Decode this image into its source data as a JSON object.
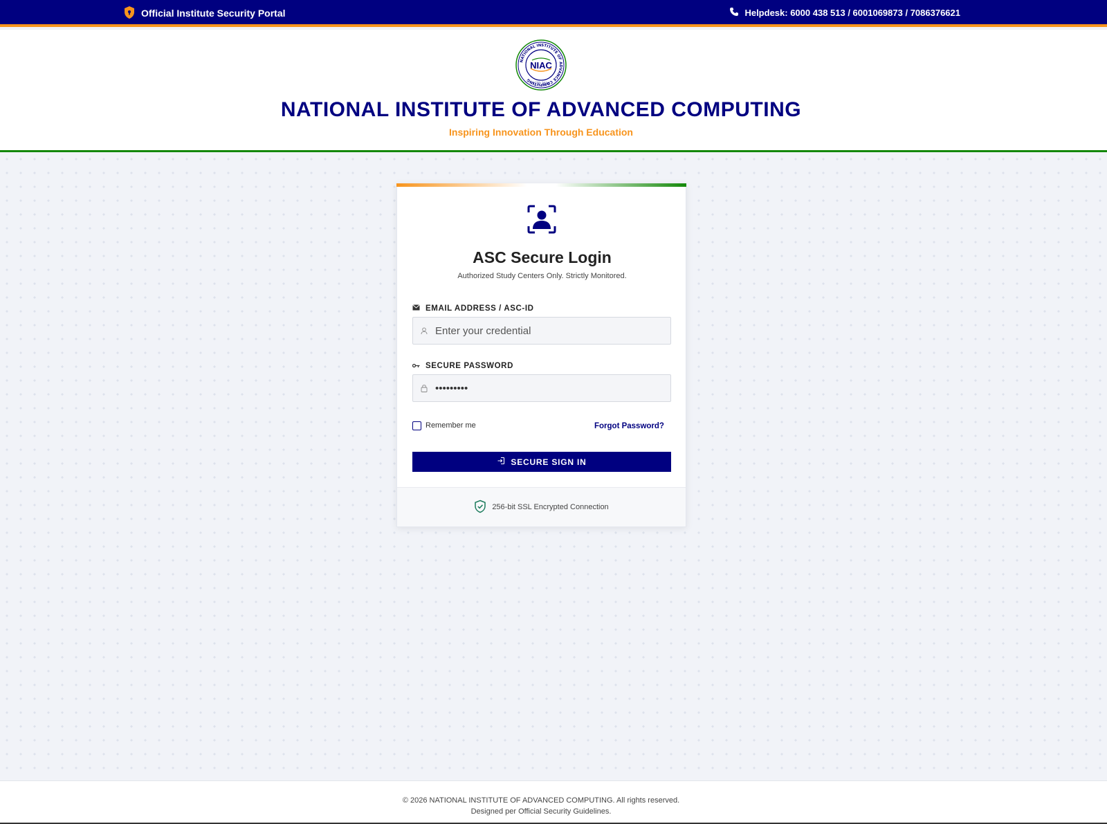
{
  "topbar": {
    "portal_label": "Official Institute Security Portal",
    "helpdesk": "Helpdesk: 6000 438 513 / 6001069873 / 7086376621",
    "bg_color": "#000080",
    "accent_color": "#f7941d"
  },
  "header": {
    "logo_text": "NIAC",
    "logo_ring_text": "NATIONAL INSTITUTE OF ADVANCE COMPUTING",
    "logo_estd": "ESTD 2016",
    "institute_name": "NATIONAL INSTITUTE OF ADVANCED COMPUTING",
    "tagline": "Inspiring Innovation Through Education",
    "border_color": "#138808"
  },
  "login": {
    "title": "ASC Secure Login",
    "subtitle": "Authorized Study Centers Only. Strictly Monitored.",
    "email_label": "EMAIL ADDRESS / ASC-ID",
    "email_placeholder": "Enter your credential",
    "password_label": "SECURE PASSWORD",
    "password_value": "•••••••••",
    "remember_label": "Remember me",
    "forgot_label": "Forgot Password?",
    "signin_label": "SECURE SIGN IN",
    "ssl_label": "256-bit SSL Encrypted Connection"
  },
  "icons": {
    "topbar_left": "shield-lock-icon",
    "topbar_right": "phone-icon",
    "card": "user-scan-icon",
    "email_label": "envelope-icon",
    "password_label": "key-icon",
    "email_field": "user-icon",
    "password_field": "lock-icon",
    "signin": "sign-in-icon",
    "ssl": "shield-check-icon"
  },
  "footer": {
    "copyright": "© 2026 NATIONAL INSTITUTE OF ADVANCED COMPUTING. All rights reserved.",
    "guidelines": "Designed per Official Security Guidelines."
  }
}
